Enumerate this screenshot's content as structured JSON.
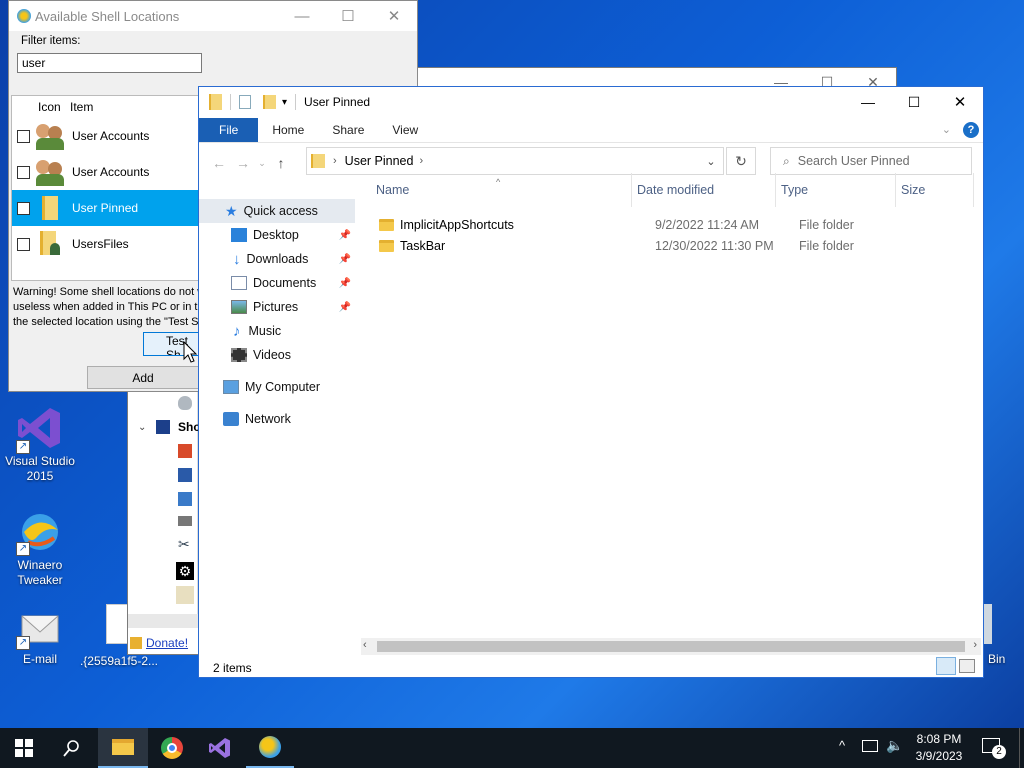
{
  "desktop": {
    "icons": [
      {
        "label": "Visual Studio 2015"
      },
      {
        "label": "Winaero Tweaker"
      },
      {
        "label": "E-mail"
      },
      {
        "label": ".{2559a1f5-2..."
      },
      {
        "label": "Bin"
      }
    ]
  },
  "bg_window": {
    "tree_label": "Sho",
    "donate": "Donate!"
  },
  "dialog": {
    "title": "Available Shell Locations",
    "filter_label": "Filter items:",
    "filter_value": "user",
    "col_icon": "Icon",
    "col_item": "Item",
    "items": [
      {
        "label": "User Accounts",
        "selected": false
      },
      {
        "label": "User Accounts",
        "selected": false
      },
      {
        "label": "User Pinned",
        "selected": true
      },
      {
        "label": "UsersFiles",
        "selected": false
      }
    ],
    "warning": [
      "Warning! Some shell locations do not w",
      "useless when added in This PC or in th",
      "the selected location using the \"Test Sh"
    ],
    "test_button": "Test Sh",
    "add_button": "Add"
  },
  "explorer": {
    "title": "User Pinned",
    "tabs": {
      "file": "File",
      "home": "Home",
      "share": "Share",
      "view": "View"
    },
    "address": "User Pinned",
    "search_placeholder": "Search User Pinned",
    "nav": {
      "quick_access": "Quick access",
      "desktop": "Desktop",
      "downloads": "Downloads",
      "documents": "Documents",
      "pictures": "Pictures",
      "music": "Music",
      "videos": "Videos",
      "my_computer": "My Computer",
      "network": "Network"
    },
    "columns": {
      "name": "Name",
      "date": "Date modified",
      "type": "Type",
      "size": "Size"
    },
    "files": [
      {
        "name": "ImplicitAppShortcuts",
        "date": "9/2/2022 11:24 AM",
        "type": "File folder"
      },
      {
        "name": "TaskBar",
        "date": "12/30/2022 11:30 PM",
        "type": "File folder"
      }
    ],
    "status": "2 items"
  },
  "taskbar": {
    "time": "8:08 PM",
    "date": "3/9/2023",
    "notif_count": "2"
  },
  "colors": {
    "accent": "#1a5fb4",
    "selection": "#00a2ed",
    "taskbar": "#101820"
  }
}
